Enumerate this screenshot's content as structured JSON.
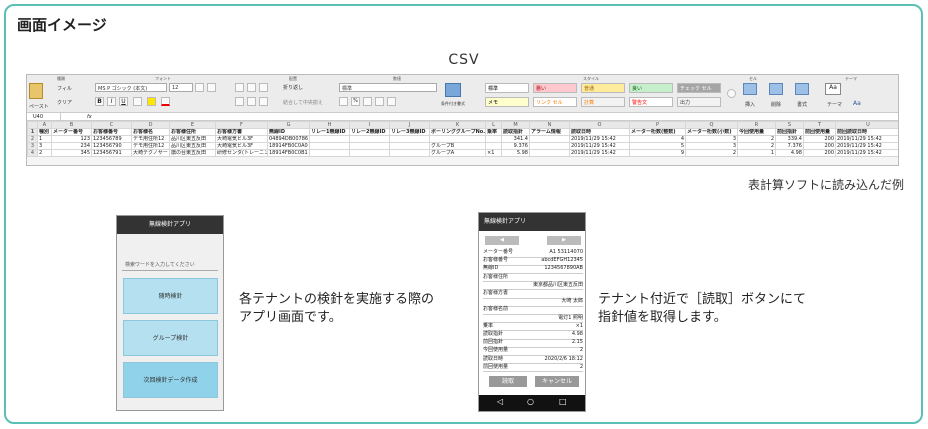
{
  "title": "画面イメージ",
  "csv_label": "CSV",
  "caption": "表計算ソフトに読み込んだ例",
  "excel": {
    "ribbon_groups": [
      "種類",
      "フォント",
      "配置",
      "数値",
      "スタイル",
      "セル",
      "テーマ"
    ],
    "paste": "ペースト",
    "fill": "フィル",
    "clear": "クリア",
    "font_name": "MS P ゴシック (本文)",
    "font_size": "12",
    "wrap": "折り返し",
    "merge": "結合して中央揃え",
    "number_format": "標準",
    "cond_format": "条件付き書式",
    "styles": [
      {
        "label": "標準",
        "bg": "#ffffff",
        "fg": "#000000"
      },
      {
        "label": "悪い",
        "bg": "#ffc7ce",
        "fg": "#9c0006"
      },
      {
        "label": "普通",
        "bg": "#ffeb9c",
        "fg": "#9c6500"
      },
      {
        "label": "良い",
        "bg": "#c6efce",
        "fg": "#006100"
      },
      {
        "label": "チェック セル",
        "bg": "#a5a5a5",
        "fg": "#ffffff"
      },
      {
        "label": "メモ",
        "bg": "#ffffcc",
        "fg": "#000000"
      },
      {
        "label": "リンク セル",
        "bg": "#ffffff",
        "fg": "#fa7d00"
      },
      {
        "label": "計算",
        "bg": "#f2f2f2",
        "fg": "#fa7d00"
      },
      {
        "label": "警告文",
        "bg": "#ffffff",
        "fg": "#ff0000"
      },
      {
        "label": "出力",
        "bg": "#f2f2f2",
        "fg": "#3f3f3f"
      }
    ],
    "cells_buttons": [
      "挿入",
      "削除",
      "書式"
    ],
    "theme_buttons": [
      "テーマ",
      "Aa"
    ],
    "name_box": "U40",
    "fx": "fx",
    "col_letters": [
      "",
      "A",
      "B",
      "C",
      "D",
      "E",
      "F",
      "G",
      "H",
      "I",
      "J",
      "K",
      "L",
      "M",
      "N",
      "O",
      "P",
      "Q",
      "R",
      "S",
      "T",
      "U"
    ],
    "header_row": [
      "1",
      "種別",
      "メーター番号",
      "お客様番号",
      "お客様名",
      "お客様住所",
      "お客様方書",
      "無線ID",
      "リレー1無線ID",
      "リレー2無線ID",
      "リレー3無線ID",
      "ポーリンググループNo.",
      "乗率",
      "読取指針",
      "アラーム情報",
      "読取日時",
      "メーター桁数(整数)",
      "メーター桁数(小数)",
      "今回使用量",
      "前回指針",
      "前回使用量",
      "前回読取日時"
    ],
    "rows": [
      [
        "2",
        "1",
        "123",
        "123456789",
        "デモ用住所12",
        "品川区東五反田",
        "大崎電気ビル3F",
        "04894DB00786",
        "",
        "",
        "",
        "",
        "",
        "341.4",
        "",
        "2019/11/29 15:42",
        "4",
        "3",
        "2",
        "339.4",
        "200",
        "2019/11/29 15:42"
      ],
      [
        "3",
        "3",
        "234",
        "123456790",
        "デモ用住所12",
        "品川区東五反田",
        "大崎電気ビル3F",
        "18914FB0C0A0",
        "",
        "",
        "",
        "グループB",
        "",
        "9.376",
        "",
        "2019/11/29 15:42",
        "5",
        "3",
        "2",
        "7.376",
        "200",
        "2019/11/29 15:42"
      ],
      [
        "4",
        "2",
        "345",
        "123456791",
        "大崎テクノサー",
        "旗の台東五反田",
        "研修センタ(トレーニング)",
        "18914FB0C0B1",
        "",
        "",
        "",
        "グループA",
        "×1",
        "5.98",
        "",
        "2019/11/29 15:42",
        "9",
        "2",
        "1",
        "4.98",
        "200",
        "2019/11/29 15:42"
      ]
    ]
  },
  "phone1": {
    "title": "無線検針アプリ",
    "search_placeholder": "検索ワードを入力してください",
    "buttons": [
      "随時検針",
      "グループ検針",
      "次回検針データ作成"
    ]
  },
  "desc1": [
    "各テナントの検針を実施する際の",
    "アプリ画面です。"
  ],
  "phone2": {
    "title": "無線検針アプリ",
    "prev": "◀",
    "next": "▶",
    "fields": [
      {
        "k": "メーター番号",
        "v": "A1 53114070"
      },
      {
        "k": "お客様番号",
        "v": "abcdEFGH12345"
      },
      {
        "k": "無線ID",
        "v": "1234567890AB"
      },
      {
        "k": "お客様住所",
        "v": ""
      },
      {
        "k": "",
        "v": "東京都品川区東五反田"
      },
      {
        "k": "お客様方書",
        "v": ""
      },
      {
        "k": "",
        "v": "大崎 太郎"
      },
      {
        "k": "お客様名前",
        "v": ""
      },
      {
        "k": "",
        "v": "電灯1 照明"
      },
      {
        "k": "乗率",
        "v": "×1"
      },
      {
        "k": "読取指針",
        "v": "4.98"
      },
      {
        "k": "前回指針",
        "v": "2.15"
      },
      {
        "k": "今回使用量",
        "v": "2"
      },
      {
        "k": "読取日時",
        "v": "2020/2/6 18:12"
      },
      {
        "k": "前回使用量",
        "v": "2"
      }
    ],
    "read_button": "読取",
    "cancel_button": "キャンセル",
    "nav_back": "◁",
    "nav_home": "○",
    "nav_recent": "□"
  },
  "desc2": [
    "テナント付近で［読取］ボタンにて",
    "指針値を取得します。"
  ]
}
